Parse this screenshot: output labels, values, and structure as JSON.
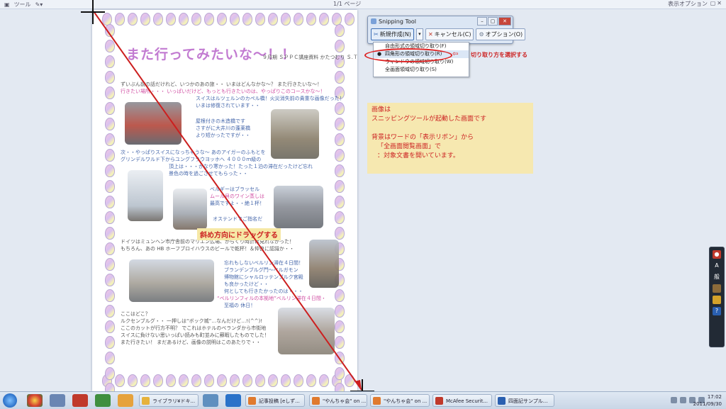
{
  "app": {
    "view_menu": "ツール",
    "pager": "1/1 ページ",
    "view_options": "表示オプション"
  },
  "document": {
    "title": "また行ってみたいな～！！",
    "subtitle": "９月期 ＳＰＰＣ講座資料 かたつむり Ｓ.Ｔ",
    "lines": [
      "ずいぶん前の話だけれど、いつかのあの旅・・ いまはどんなかな～？ また行きたいな～！",
      "行きたい場所・・・ いっぱいだけど、もっとも行きたいのは、やっぱりこのコースかな～！",
      "スイスはルツェルンのカペル橋！火災消失前の貴重な画像だった！",
      "いまは修復されています・・",
      "屋根付きの木造橋です",
      "さすがに大井川の蓬莱橋",
      "より短かったですが・・",
      "次・・やっぱりスイスになっちゃうな～ あのアイガーのふもとを",
      "グリンデルワルド下からユングフラウヨッホへ ４０００ｍ級の",
      "頂上は・・・かなり寒かった！たった１泊の滞在だったけど忘れ",
      "景色の時を過ごさせてもらった・・",
      "ベルギーはブラッセル",
      "ムール貝のワイン蒸しは",
      "最高ですよ・・絶１杯！",
      "オステンドでご指名だ",
      "ドイツはミュンヘン市庁舎前のマリエン広場、からくり時計は見れなかった！",
      "もちろん、あの HB ホーフブロイハウスのビールで乾杯！＆仲良に認識か・・",
      "忘れもしないベルリン滞在４日間！",
      "ブランデンブルグ門～ベルガモン",
      "博物館にシャルロッテンブルク宮殿",
      "も良かったけど・・",
      "何としても行きたかったのは・・・",
      "“ベルリンフィルの本拠地”ベルリン滞在４日間・",
      "至福の 休日！",
      "ここはどこ？",
      "ルクセンブルグ・・ 一押しは“ボック城”…なんだけど…!(^^)!",
      "ここのカットが行方不明？ でこれはホテルのベランダから市街地",
      "スイスに負けない思いっぱい読みも町並みに蘇暇したものでした！",
      "また行きたい！ まだあるけど、画像の説明はこのあたりで・・"
    ],
    "drag_label": "斜め方向にドラッグする"
  },
  "snipping_tool": {
    "title": "Snipping Tool",
    "new_button": "新規作成(N)",
    "cancel_button": "キャンセル(C)",
    "options_button": "オプション(O)",
    "menu_items": [
      "自由形式の領域切り取り(F)",
      "四角形の領域切り取り(R)",
      "ウィンドウの領域切り取り(W)",
      "全画面領域切り取り(S)"
    ],
    "selected_index": 1,
    "annotation": "切り取り方を選択する"
  },
  "note": {
    "lines": [
      "画像は",
      "スニッピングツールが起動した画面です",
      "",
      "背景はワードの「表示リボン」から",
      "「全画面閲覧画面」で",
      "：対象文書を開いています。"
    ]
  },
  "taskbar": {
    "tasks": [
      "ライブラリ¥ドキ...",
      "記事投稿 [eしず...",
      "\"やんちゃ会\" on ...",
      "\"やんちゃ会\" on ...",
      "McAfee Securit...",
      "四面記サンプル..."
    ],
    "time": "17:02",
    "date": "2011/09/30"
  },
  "language_bar": {
    "mode": "A",
    "kanji": "般"
  },
  "colors": {
    "annotation_red": "#cc2222",
    "note_bg": "#f6e8b0",
    "desktop_bg": "#e3e9f2",
    "title_pink": "#c27bd1"
  }
}
